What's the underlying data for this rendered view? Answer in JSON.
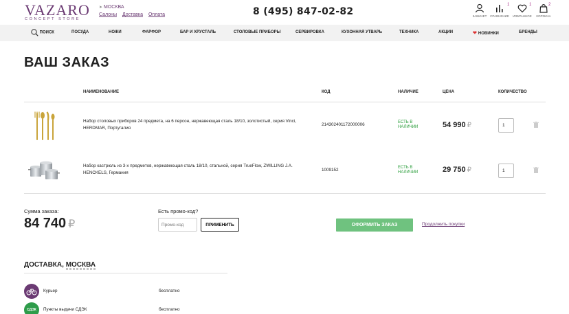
{
  "header": {
    "logo": "VAZARO",
    "logo_sub": "CONCEPT STORE",
    "city": "Москва",
    "links": [
      "Салоны",
      "Доставка",
      "Оплата"
    ],
    "phone": "8 (495) 847-02-82",
    "icons": [
      {
        "name": "user-icon",
        "label": "Кабинет",
        "badge": ""
      },
      {
        "name": "compare-icon",
        "label": "Сравнение",
        "badge": "1"
      },
      {
        "name": "heart-icon",
        "label": "Избранное",
        "badge": "1"
      },
      {
        "name": "bag-icon",
        "label": "Корзина",
        "badge": "2"
      }
    ]
  },
  "nav": {
    "search": "Поиск",
    "items": [
      "Посуда",
      "Ножи",
      "Фарфор",
      "Бар и хрусталь",
      "Столовые приборы",
      "Сервировка",
      "Кухонная утварь",
      "Техника",
      "Акции",
      "Новинки",
      "Бренды"
    ]
  },
  "page": {
    "title": "Ваш заказ"
  },
  "table": {
    "headers": {
      "name": "Наименование",
      "code": "Код",
      "stock": "Наличие",
      "price": "Цена",
      "qty": "Количество"
    },
    "rows": [
      {
        "name": "Набор столовых приборов 24 предмета, на 6 персон, нержавеющая сталь 18/10, золотистый, серия Vinci, HERDMAR, Португалия",
        "code": "214302401172000006",
        "stock": "Есть в наличии",
        "price": "54 990",
        "qty": "1"
      },
      {
        "name": "Набор кастрюль из 3-х предметов, нержавеющая сталь 18/10, стальной, серия TrueFlow, ZWILLING J.A. HENCKELS, Германия",
        "code": "1009152",
        "stock": "Есть в наличии",
        "price": "29 750",
        "qty": "1"
      }
    ],
    "currency": "₽"
  },
  "summary": {
    "label": "Сумма заказа:",
    "total": "84 740",
    "promo_label": "Есть промо-код?",
    "promo_placeholder": "Промо-код",
    "promo_button": "Применить",
    "order_button": "Оформить заказ",
    "continue_link": "Продолжить покупки"
  },
  "delivery": {
    "title_prefix": "Доставка,",
    "city": "Москва",
    "options": [
      {
        "icon": "courier-icon",
        "icon_text": "",
        "name": "Курьер",
        "price": "бесплатно"
      },
      {
        "icon": "cdek-icon",
        "icon_text": "СДЭК",
        "name": "Пункты выдачи СДЭК",
        "price": "бесплатно"
      }
    ]
  },
  "colors": {
    "brand": "#6b3a73",
    "accent_green": "#6fc27f",
    "stock_green": "#2a9d3a"
  }
}
